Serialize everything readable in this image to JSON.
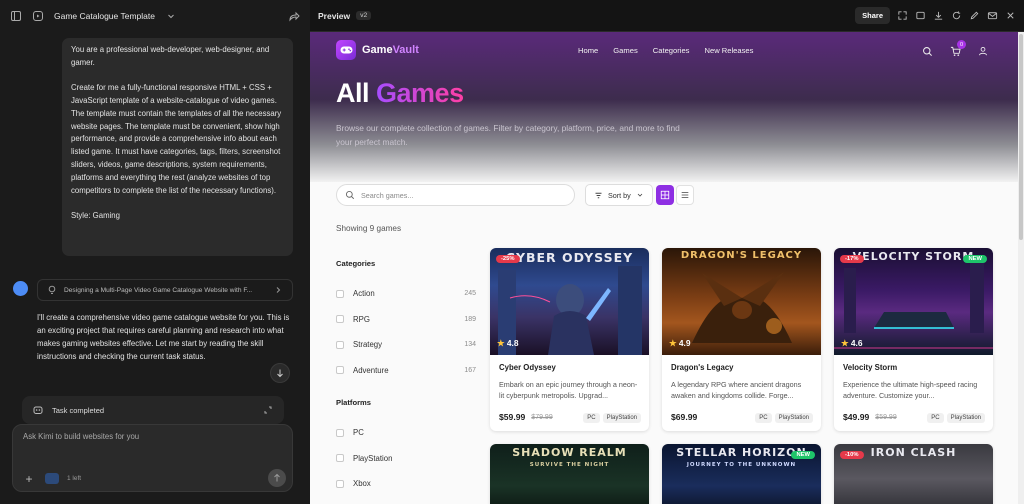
{
  "left": {
    "title": "Game Catalogue Template",
    "user_prompt": [
      "You are a professional web-developer, web-designer, and gamer.",
      "Create for me a fully-functional responsive HTML + CSS + JavaScript template of a website-catalogue of video games. The template must contain the templates of all the necessary website pages. The template must be convenient, show high performance, and provide a comprehensive info about each listed game. It must have categories, tags, filters, screenshot sliders, videos, game descriptions, system requirements, platforms and everything the rest (analyze websites of top competitors to complete the list of the necessary functions).",
      "Style: Gaming"
    ],
    "task_chip": "Designing a Multi-Page Video Game Catalogue Website with F...",
    "reply": "I'll create a comprehensive video game catalogue website for you. This is an exciting project that requires careful planning and research into what makes gaming websites effective. Let me start by reading the skill instructions and checking the current task status.",
    "task_completed": "Task completed",
    "composer_placeholder": "Ask Kimi to build websites for you",
    "count_left": "1 left"
  },
  "preview": {
    "label": "Preview",
    "version": "v2",
    "share": "Share"
  },
  "site": {
    "brand_a": "Game",
    "brand_b": "Vault",
    "nav": [
      "Home",
      "Games",
      "Categories",
      "New Releases"
    ],
    "cart_count": "0",
    "hero_title_a": "All",
    "hero_title_b": "Games",
    "hero_sub": "Browse our complete collection of games. Filter by category, platform, price, and more to find your perfect match.",
    "search_placeholder": "Search games...",
    "sort_label": "Sort by",
    "showing": "Showing 9 games",
    "categories_head": "Categories",
    "categories": [
      {
        "label": "Action",
        "count": "245"
      },
      {
        "label": "RPG",
        "count": "189"
      },
      {
        "label": "Strategy",
        "count": "134"
      },
      {
        "label": "Adventure",
        "count": "167"
      }
    ],
    "platforms_head": "Platforms",
    "platforms": [
      "PC",
      "PlayStation",
      "Xbox"
    ],
    "games": [
      {
        "art_title": "CYBER ODYSSEY",
        "badge": "-25%",
        "rating": "4.8",
        "name": "Cyber Odyssey",
        "desc": "Embark on an epic journey through a neon-lit cyberpunk metropolis. Upgrad...",
        "price": "$59.99",
        "old": "$79.99",
        "tags": [
          "PC",
          "PlayStation"
        ]
      },
      {
        "art_title": "DRAGON'S LEGACY",
        "badge": "",
        "rating": "4.9",
        "name": "Dragon's Legacy",
        "desc": "A legendary RPG where ancient dragons awaken and kingdoms collide. Forge...",
        "price": "$69.99",
        "old": "",
        "tags": [
          "PC",
          "PlayStation"
        ]
      },
      {
        "art_title": "VELOCITY STORM",
        "badge": "-17%",
        "new": "NEW",
        "rating": "4.6",
        "name": "Velocity Storm",
        "desc": "Experience the ultimate high-speed racing adventure. Customize your...",
        "price": "$49.99",
        "old": "$59.99",
        "tags": [
          "PC",
          "PlayStation"
        ]
      },
      {
        "art_title": "SHADOW REALM",
        "badge": "",
        "art_sub": "SURVIVE THE NIGHT"
      },
      {
        "art_title": "STELLAR HORIZON",
        "badge": "",
        "new": "NEW",
        "art_sub": "JOURNEY TO THE UNKNOWN"
      },
      {
        "art_title": "IRON CLASH",
        "badge": "-10%"
      }
    ]
  }
}
